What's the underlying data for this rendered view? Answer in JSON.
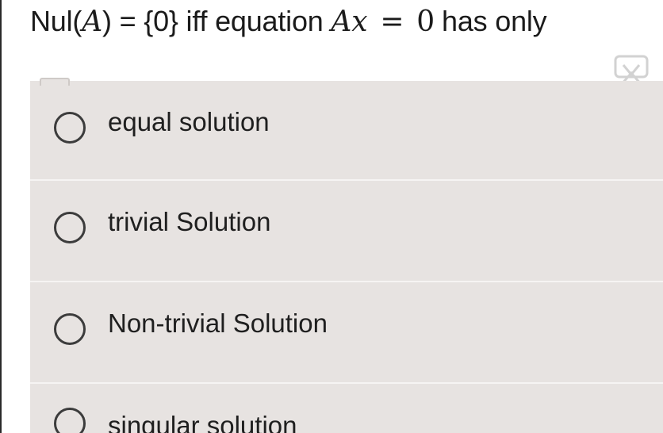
{
  "question": {
    "prefix": "Nul(",
    "matrix_symbol": "A",
    "middle": ") = {0} iff equation ",
    "expr_lhs": "Ax",
    "equals": "=",
    "expr_rhs": "0",
    "suffix": "has only"
  },
  "options": [
    {
      "label": "equal solution",
      "selected": false
    },
    {
      "label": "trivial Solution",
      "selected": false
    },
    {
      "label": "Non-trivial Solution",
      "selected": false
    },
    {
      "label": "singular solution",
      "selected": false
    }
  ],
  "icons": {
    "expand": "expand-icon"
  },
  "colors": {
    "option_background": "#e7e3e1",
    "divider": "#f6f4f3",
    "radio_border": "#3c3c3c",
    "text": "#1b1b1b"
  }
}
